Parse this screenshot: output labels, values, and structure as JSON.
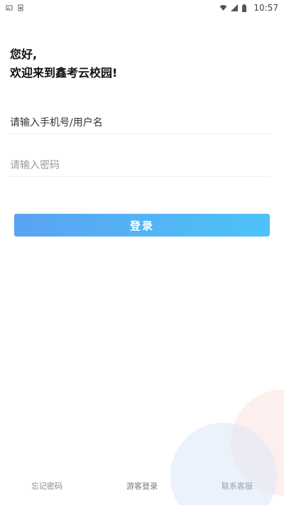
{
  "status_bar": {
    "time": "10:57"
  },
  "greeting": {
    "line1": "您好,",
    "line2": "欢迎来到鑫考云校园!"
  },
  "form": {
    "username_placeholder": "请输入手机号/用户名",
    "password_placeholder": "请输入密码",
    "login_label": "登录"
  },
  "footer": {
    "forgot_password": "忘记密码",
    "guest_login": "游客登录",
    "contact_support": "联系客服"
  },
  "colors": {
    "button_gradient_start": "#5aa3f2",
    "button_gradient_end": "#4cc3f8",
    "background": "#ffffff"
  },
  "icons": [
    "image-icon",
    "sim-icon",
    "wifi-icon",
    "cellular-signal-icon",
    "battery-icon"
  ]
}
